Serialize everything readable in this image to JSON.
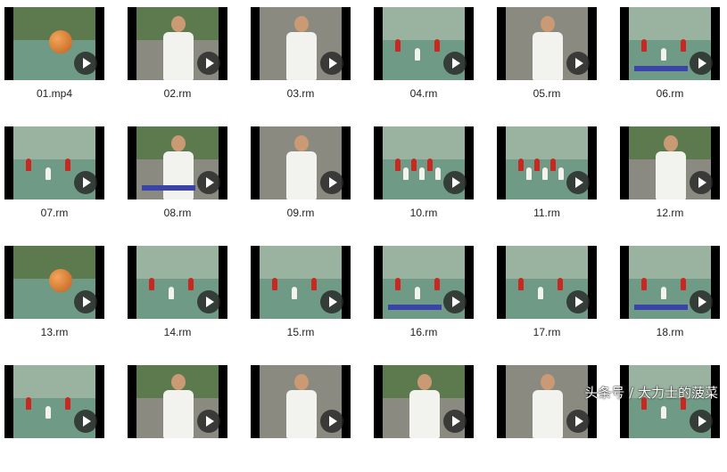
{
  "files": [
    {
      "name": "01.mp4",
      "scene": "ball"
    },
    {
      "name": "02.rm",
      "scene": "coach"
    },
    {
      "name": "03.rm",
      "scene": "coach"
    },
    {
      "name": "04.rm",
      "scene": "court"
    },
    {
      "name": "05.rm",
      "scene": "coach"
    },
    {
      "name": "06.rm",
      "scene": "court-banner"
    },
    {
      "name": "07.rm",
      "scene": "court"
    },
    {
      "name": "08.rm",
      "scene": "coach-banner"
    },
    {
      "name": "09.rm",
      "scene": "coach"
    },
    {
      "name": "10.rm",
      "scene": "court-team"
    },
    {
      "name": "11.rm",
      "scene": "court-team"
    },
    {
      "name": "12.rm",
      "scene": "coach"
    },
    {
      "name": "13.rm",
      "scene": "ball"
    },
    {
      "name": "14.rm",
      "scene": "court"
    },
    {
      "name": "15.rm",
      "scene": "court"
    },
    {
      "name": "16.rm",
      "scene": "court-banner"
    },
    {
      "name": "17.rm",
      "scene": "court"
    },
    {
      "name": "18.rm",
      "scene": "court-banner"
    },
    {
      "name": "",
      "scene": "court"
    },
    {
      "name": "",
      "scene": "coach"
    },
    {
      "name": "",
      "scene": "coach"
    },
    {
      "name": "",
      "scene": "coach"
    },
    {
      "name": "",
      "scene": "coach"
    },
    {
      "name": "",
      "scene": "court"
    }
  ],
  "watermark": "头条号 / 大力士的菠菜",
  "colors": {
    "court": "#6e9a86",
    "sky": "#9ab3a0",
    "tree": "#5c7a4e",
    "wall": "#8a8a80",
    "shirt_white": "#f2f2ee",
    "shirt_red": "#c8281f",
    "play_button": "#282828"
  }
}
